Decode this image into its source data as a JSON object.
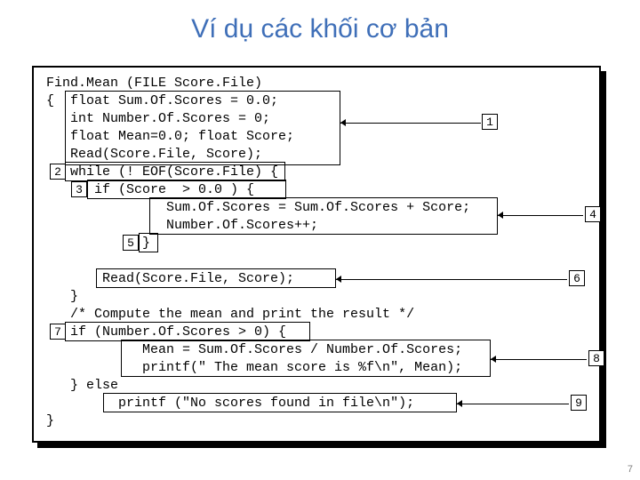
{
  "title": "Ví dụ các khối cơ bản",
  "code": {
    "l1": "Find.Mean (FILE Score.File)",
    "l2": "{  float Sum.Of.Scores = 0.0;",
    "l3": "   int Number.Of.Scores = 0;",
    "l4": "   float Mean=0.0; float Score;",
    "l5": "   Read(Score.File, Score);",
    "l6": "   while (! EOF(Score.File) {",
    "l7": "      if (Score  > 0.0 ) {",
    "l8": "               Sum.Of.Scores = Sum.Of.Scores + Score;",
    "l9": "               Number.Of.Scores++;",
    "l10": "            }",
    "l11": "",
    "l12": "       Read(Score.File, Score);",
    "l13": "   }",
    "l14": "   /* Compute the mean and print the result */",
    "l15": "   if (Number.Of.Scores > 0) {",
    "l16": "            Mean = Sum.Of.Scores / Number.Of.Scores;",
    "l17": "            printf(\" The mean score is %f\\n\", Mean);",
    "l18": "   } else",
    "l19": "         printf (\"No scores found in file\\n\");",
    "l20": "}"
  },
  "labels": {
    "n1": "1",
    "n2": "2",
    "n3": "3",
    "n4": "4",
    "n5": "5",
    "n6": "6",
    "n7": "7",
    "n8": "8",
    "n9": "9"
  },
  "page": "7"
}
